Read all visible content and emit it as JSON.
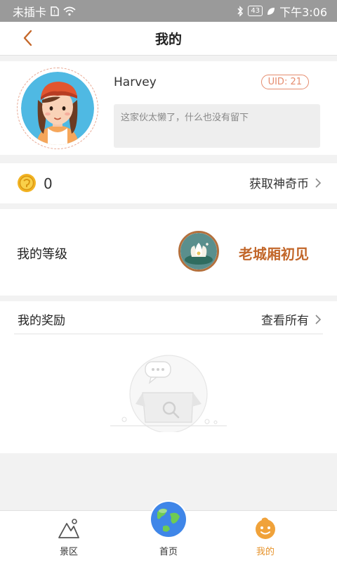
{
  "status_bar": {
    "carrier": "未插卡",
    "battery": "43",
    "time": "下午3:06"
  },
  "nav": {
    "title": "我的"
  },
  "profile": {
    "username": "Harvey",
    "uid": "UID: 21",
    "bio": "这家伙太懒了，什么也没有留下"
  },
  "coins": {
    "count": "0",
    "link_label": "获取神奇币"
  },
  "level": {
    "label": "我的等级",
    "name": "老城厢初见"
  },
  "rewards": {
    "title": "我的奖励",
    "link_label": "查看所有"
  },
  "tabbar": {
    "items": [
      {
        "label": "景区",
        "icon": "mountain-icon"
      },
      {
        "label": "首页",
        "icon": "globe-icon"
      },
      {
        "label": "我的",
        "icon": "smiley-icon",
        "active": true
      }
    ]
  },
  "colors": {
    "accent": "#e6922a",
    "level_text": "#c2672a",
    "uid_border": "#e58c6e"
  }
}
